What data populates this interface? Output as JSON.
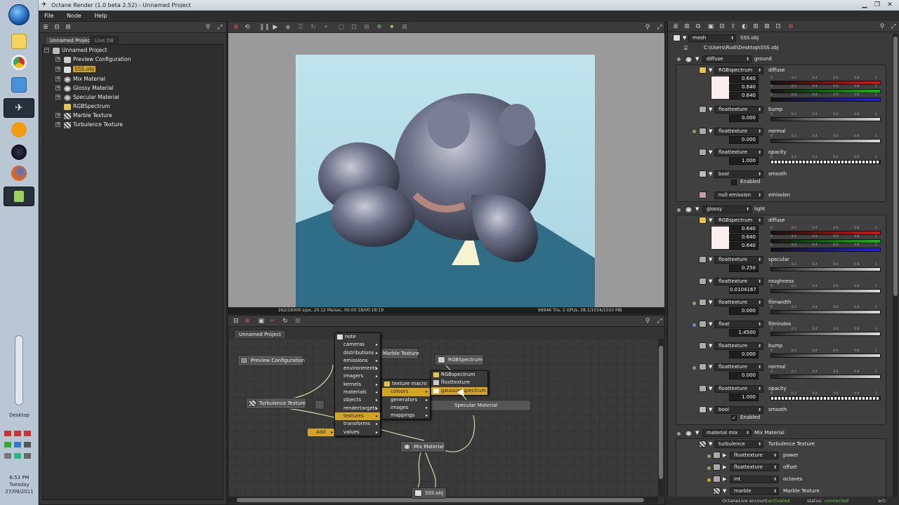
{
  "window": {
    "title": "Octane Render (1.0 beta 2.52) - Unnamed Project"
  },
  "menubar": {
    "items": [
      "File",
      "Node",
      "Help"
    ]
  },
  "taskbar": {
    "desktop_label": "Desktop",
    "clock_time": "6:53 PM",
    "clock_day": "Tuesday",
    "clock_date": "27/09/2011"
  },
  "outliner": {
    "tabs": [
      "Unnamed Project",
      "Live DB"
    ],
    "root": "Unnamed Project",
    "items": [
      {
        "label": "Preview Configuration",
        "icon": "config-icon"
      },
      {
        "label": "SSS.obj",
        "icon": "mesh-icon",
        "selected": true
      },
      {
        "label": "Mix Material",
        "icon": "mix-material-icon"
      },
      {
        "label": "Glossy Material",
        "icon": "glossy-material-icon"
      },
      {
        "label": "Specular Material",
        "icon": "specular-material-icon"
      },
      {
        "label": "RGBSpectrum",
        "icon": "rgb-icon"
      },
      {
        "label": "Marble Texture",
        "icon": "texture-icon"
      },
      {
        "label": "Turbulence Texture",
        "icon": "texture-icon"
      }
    ]
  },
  "render": {
    "status_left": "262/16000 s/px, 20.12 Ms/sec, 00:00:18/00:18:19",
    "status_right": "66946 Tris, 2 GPUs, 38.1/1034/1503 MB"
  },
  "nodegraph": {
    "tab": "Unnamed Project",
    "nodes": [
      {
        "label": "Preview Configuration"
      },
      {
        "label": "Turbulence Texture"
      },
      {
        "label": "RGBSpectrum"
      },
      {
        "label": "Marble Texture"
      },
      {
        "label": "Specular Material"
      },
      {
        "label": "Mix Material"
      },
      {
        "label": "SSS.obj"
      }
    ],
    "add_button": "Add",
    "menu1": [
      "note",
      "cameras",
      "distributions",
      "emissions",
      "environments",
      "imagers",
      "kernels",
      "materials",
      "objects",
      "rendertargets",
      "textures",
      "transforms",
      "values"
    ],
    "menu2": [
      "texture macro",
      "colours",
      "generators",
      "images",
      "mappings"
    ],
    "menu3": [
      "RGBspectrum",
      "floattexture",
      "gaussianspectrum"
    ]
  },
  "attributes": {
    "header_type": "mesh",
    "header_name": "SSS.obj",
    "path": "C:\\Users\\Rudi\\Desktop\\SSS.obj",
    "diffuse_section": {
      "type": "diffuse",
      "name": "ground"
    },
    "glossy_section": {
      "type": "glossy",
      "name": "light"
    },
    "mix_section": {
      "type": "material mix",
      "name": "Mix Material"
    },
    "rows": [
      {
        "type": "RGBspectrum",
        "name": "diffuse",
        "values": [
          "0.640",
          "0.640",
          "0.640"
        ]
      },
      {
        "type": "floattexture",
        "name": "bump",
        "value": "0.000"
      },
      {
        "type": "floattexture",
        "name": "normal",
        "value": "0.000"
      },
      {
        "type": "floattexture",
        "name": "opacity",
        "value": "1.000"
      },
      {
        "type": "bool",
        "name": "smooth",
        "value": "Enabled"
      },
      {
        "type": "null emission",
        "name": "emission"
      },
      {
        "type": "RGBspectrum",
        "name": "diffuse",
        "values": [
          "0.640",
          "0.640",
          "0.640"
        ]
      },
      {
        "type": "floattexture",
        "name": "specular",
        "value": "0.250"
      },
      {
        "type": "floattexture",
        "name": "roughness",
        "value": "0.0104167"
      },
      {
        "type": "floattexture",
        "name": "filmwidth",
        "value": "0.000"
      },
      {
        "type": "float",
        "name": "filmindex",
        "value": "1.4500"
      },
      {
        "type": "floattexture",
        "name": "bump",
        "value": "0.000"
      },
      {
        "type": "floattexture",
        "name": "normal",
        "value": "0.000"
      },
      {
        "type": "floattexture",
        "name": "opacity",
        "value": "1.000"
      },
      {
        "type": "bool",
        "name": "smooth",
        "value": "Enabled"
      }
    ],
    "mix_rows": [
      {
        "type": "turbulence",
        "name": "Turbulence Texture"
      },
      {
        "type": "floattexture",
        "name": "power"
      },
      {
        "type": "floattexture",
        "name": "offset"
      },
      {
        "type": "int",
        "name": "octaves"
      },
      {
        "type": "marble",
        "name": "Marble Texture"
      }
    ],
    "ticks": [
      "0",
      "0.2",
      "0.4",
      "0.6",
      "0.8",
      "1"
    ],
    "footer": {
      "account_label": "OctaneLive account:",
      "account_value": "activated",
      "status_label": "status:",
      "status_value": "connected",
      "act_label": "act:"
    }
  }
}
